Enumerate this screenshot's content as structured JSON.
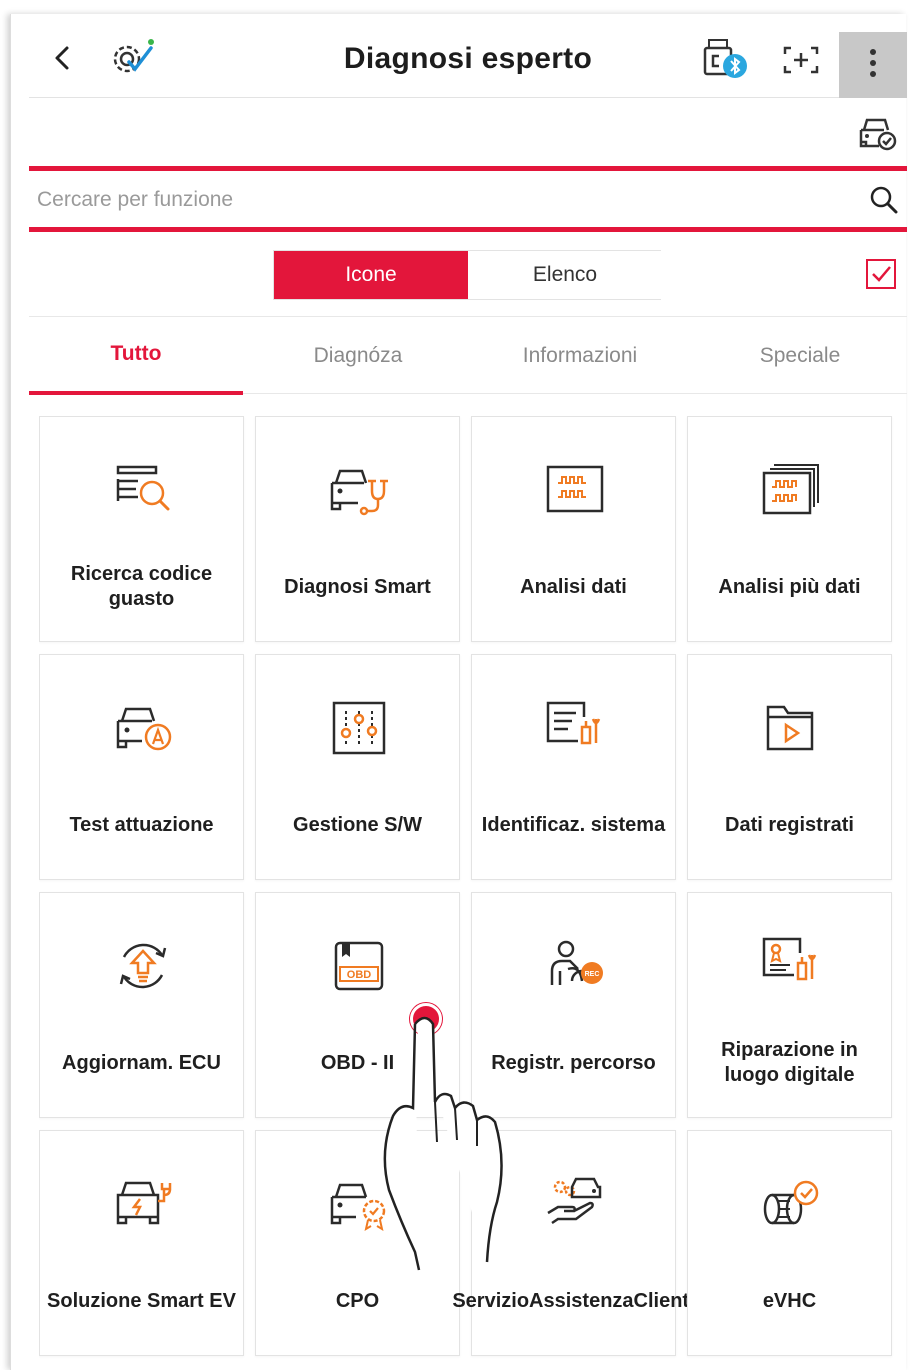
{
  "header": {
    "title": "Diagnosi esperto",
    "back_icon": "chevron-left-icon",
    "icons": [
      "gear-check-icon",
      "vci-bluetooth-icon",
      "scan-add-icon",
      "more-vertical-icon"
    ]
  },
  "toolbar": {
    "car_check_icon": "car-check-icon"
  },
  "search": {
    "placeholder": "Cercare per funzione",
    "value": ""
  },
  "view_toggle": {
    "icons_label": "Icone",
    "list_label": "Elenco",
    "selected": "Icone"
  },
  "tabs": [
    {
      "label": "Tutto",
      "active": true
    },
    {
      "label": "Diagnóza",
      "active": false
    },
    {
      "label": "Informazioni",
      "active": false
    },
    {
      "label": "Speciale",
      "active": false
    }
  ],
  "functions": [
    {
      "label": "Ricerca codice guasto",
      "icon": "dtc-search-icon"
    },
    {
      "label": "Diagnosi Smart",
      "icon": "car-stethoscope-icon"
    },
    {
      "label": "Analisi dati",
      "icon": "data-waveform-icon"
    },
    {
      "label": "Analisi più dati",
      "icon": "multi-data-waveform-icon"
    },
    {
      "label": "Test attuazione",
      "icon": "car-actuation-icon"
    },
    {
      "label": "Gestione S/W",
      "icon": "sliders-icon"
    },
    {
      "label": "Identificaz. sistema",
      "icon": "document-tools-icon"
    },
    {
      "label": "Dati registrati",
      "icon": "folder-play-icon"
    },
    {
      "label": "Aggiornam. ECU",
      "icon": "ecu-update-icon"
    },
    {
      "label": "OBD - II",
      "icon": "obd-icon"
    },
    {
      "label": "Registr. percorso",
      "icon": "driver-record-icon"
    },
    {
      "label": "Riparazione in luogo digitale",
      "icon": "certificate-tools-icon"
    },
    {
      "label": "Soluzione Smart EV",
      "icon": "ev-car-plug-icon"
    },
    {
      "label": "CPO",
      "icon": "car-badge-icon"
    },
    {
      "label": "ServizioAssistenzaClienti",
      "icon": "hand-service-icon"
    },
    {
      "label": "eVHC",
      "icon": "tire-check-icon"
    }
  ],
  "colors": {
    "accent": "#e3163b",
    "icon_orange": "#f07b22",
    "icon_dark": "#2b2b2b"
  }
}
